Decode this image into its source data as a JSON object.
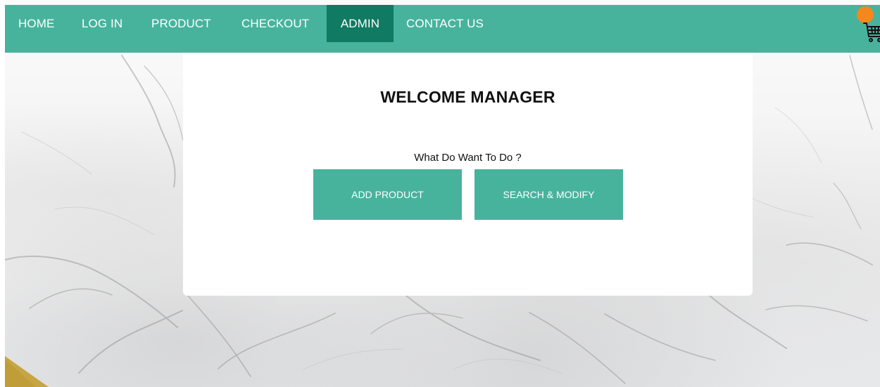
{
  "nav": {
    "items": [
      {
        "label": "HOME"
      },
      {
        "label": "LOG IN"
      },
      {
        "label": "PRODUCT"
      },
      {
        "label": "CHECKOUT"
      },
      {
        "label": "ADMIN"
      },
      {
        "label": "CONTACT US"
      }
    ],
    "active": "ADMIN"
  },
  "cart": {
    "icon": "shopping-cart-icon",
    "badge_color": "#f4871e"
  },
  "admin": {
    "title": "WELCOME MANAGER",
    "prompt": "What Do Want To Do ?",
    "buttons": {
      "add_product": "ADD PRODUCT",
      "search_modify": "SEARCH & MODIFY"
    }
  },
  "colors": {
    "navbar": "#47b39d",
    "active_nav": "#107a62",
    "button": "#47b39d",
    "button_text": "#ffffff",
    "title_text": "#111111",
    "badge": "#f4871e",
    "gold_accent": "#c6a642"
  }
}
